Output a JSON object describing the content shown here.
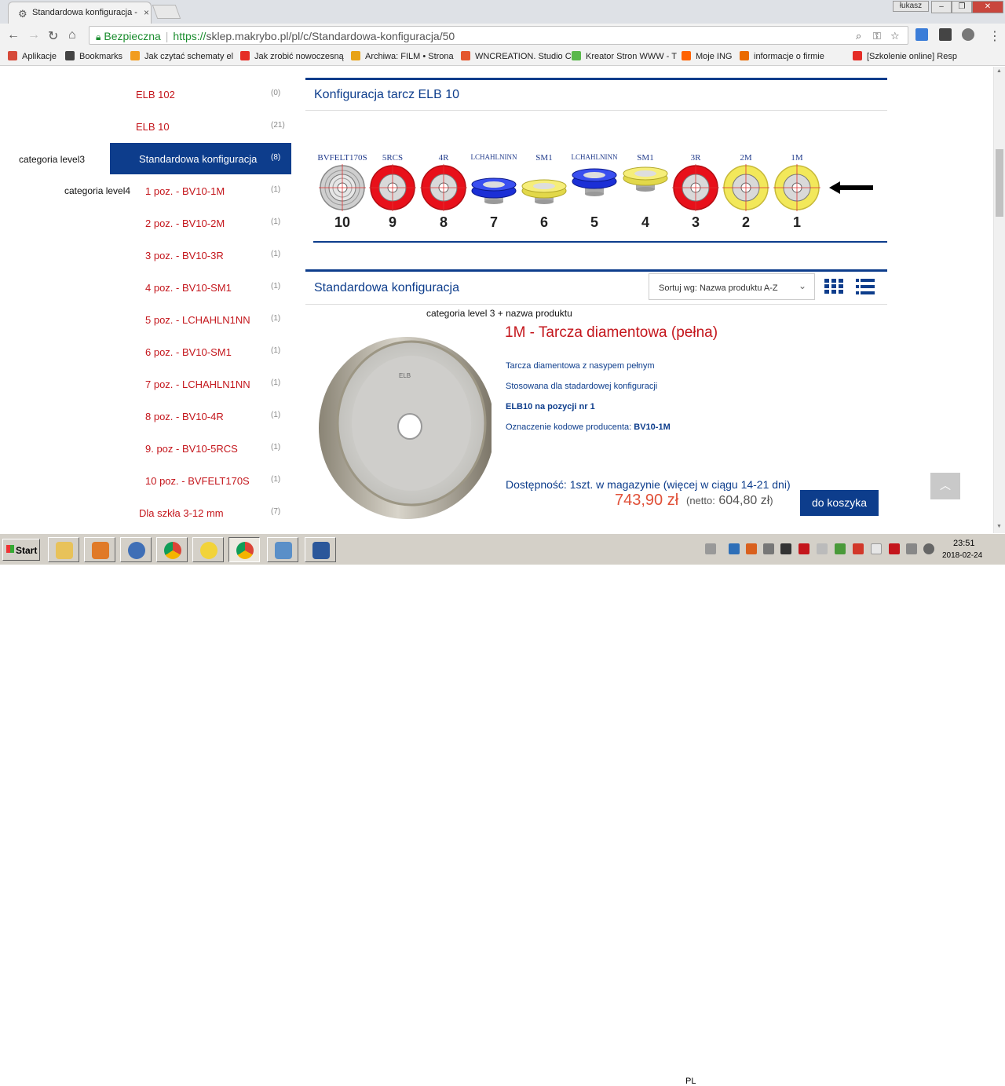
{
  "browser": {
    "tab_title": "Standardowa konfiguracja -",
    "tab_close": "×",
    "user_chip": "łukasz",
    "win_min": "–",
    "win_max": "❐",
    "win_close": "✕",
    "secure_label": "Bezpieczna",
    "url_scheme": "https://",
    "url_rest": "sklep.makrybo.pl/pl/c/Standardowa-konfiguracja/50"
  },
  "bookmarks": [
    {
      "label": "Aplikacje",
      "color": "#d64a3a"
    },
    {
      "label": "Bookmarks",
      "color": "#444444"
    },
    {
      "label": "Jak czytać schematy el",
      "color": "#f29d1f"
    },
    {
      "label": "Jak zrobić nowoczesną",
      "color": "#e52d27"
    },
    {
      "label": "Archiwa: FILM • Strona",
      "color": "#e8a317"
    },
    {
      "label": "WNCREATION. Studio C",
      "color": "#e4572e"
    },
    {
      "label": "Kreator Stron WWW - T",
      "color": "#59b84a"
    },
    {
      "label": "Moje ING",
      "color": "#ff6200"
    },
    {
      "label": "informacje o firmie",
      "color": "#ea6a00"
    },
    {
      "label": "[Szkolenie online] Resp",
      "color": "#e52d27"
    }
  ],
  "sidebar": {
    "items": [
      {
        "label": "ELB 102",
        "count": "(0)"
      },
      {
        "label": "ELB 10",
        "count": "(21)"
      },
      {
        "label": "Standardowa konfiguracja",
        "count": "(8)"
      },
      {
        "label": "1 poz. - BV10-1M",
        "count": "(1)"
      },
      {
        "label": "2 poz. - BV10-2M",
        "count": "(1)"
      },
      {
        "label": "3 poz. - BV10-3R",
        "count": "(1)"
      },
      {
        "label": "4 poz. - BV10-SM1",
        "count": "(1)"
      },
      {
        "label": "5 poz. - LCHAHLN1NN",
        "count": "(1)"
      },
      {
        "label": "6 poz. - BV10-SM1",
        "count": "(1)"
      },
      {
        "label": "7 poz. - LCHAHLN1NN",
        "count": "(1)"
      },
      {
        "label": "8 poz. - BV10-4R",
        "count": "(1)"
      },
      {
        "label": "9. poz - BV10-5RCS",
        "count": "(1)"
      },
      {
        "label": "10 poz. - BVFELT170S",
        "count": "(1)"
      },
      {
        "label": "Dla szkła 3-12 mm",
        "count": "(7)"
      }
    ]
  },
  "annotations": {
    "level3": "categoria level3",
    "level4": "categoria level4",
    "level3_product": "categoria level 3 + nazwa produktu"
  },
  "config": {
    "title": "Konfiguracja tarcz ELB 10",
    "discs": [
      {
        "label": "BVFELT170S",
        "num": "10",
        "kind": "felt"
      },
      {
        "label": "5RCS",
        "num": "9",
        "kind": "red"
      },
      {
        "label": "4R",
        "num": "8",
        "kind": "red"
      },
      {
        "label": "LCHAHLNINN",
        "num": "7",
        "kind": "blue"
      },
      {
        "label": "SM1",
        "num": "6",
        "kind": "yellow-side"
      },
      {
        "label": "LCHAHLNINN",
        "num": "5",
        "kind": "blue"
      },
      {
        "label": "SM1",
        "num": "4",
        "kind": "yellow-side"
      },
      {
        "label": "3R",
        "num": "3",
        "kind": "red"
      },
      {
        "label": "2M",
        "num": "2",
        "kind": "yellow"
      },
      {
        "label": "1M",
        "num": "1",
        "kind": "yellow"
      }
    ]
  },
  "listing": {
    "title": "Standardowa konfiguracja",
    "sort_label": "Sortuj wg: Nazwa produktu A-Z"
  },
  "product": {
    "title": "1M - Tarcza diamentowa (pełna)",
    "desc1": "Tarcza diamentowa z nasypem pełnym",
    "desc2": "Stosowana dla stadardowej konfiguracji",
    "desc3": "ELB10 na pozycji nr 1",
    "code_label": "Oznaczenie kodowe producenta:",
    "code_value": "BV10-1M",
    "wheel_text": "ELB",
    "availability": "Dostępność: 1szt. w magazynie (więcej w ciągu 14-21 dni)",
    "price": "743,90 zł",
    "netto_prefix": "(netto:",
    "netto_value": "604,80 zł",
    "netto_suffix": ")",
    "cart_label": "do koszyka"
  },
  "taskbar": {
    "start_label": "Start",
    "lang": "PL",
    "time": "23:51",
    "date": "2018-02-24"
  }
}
